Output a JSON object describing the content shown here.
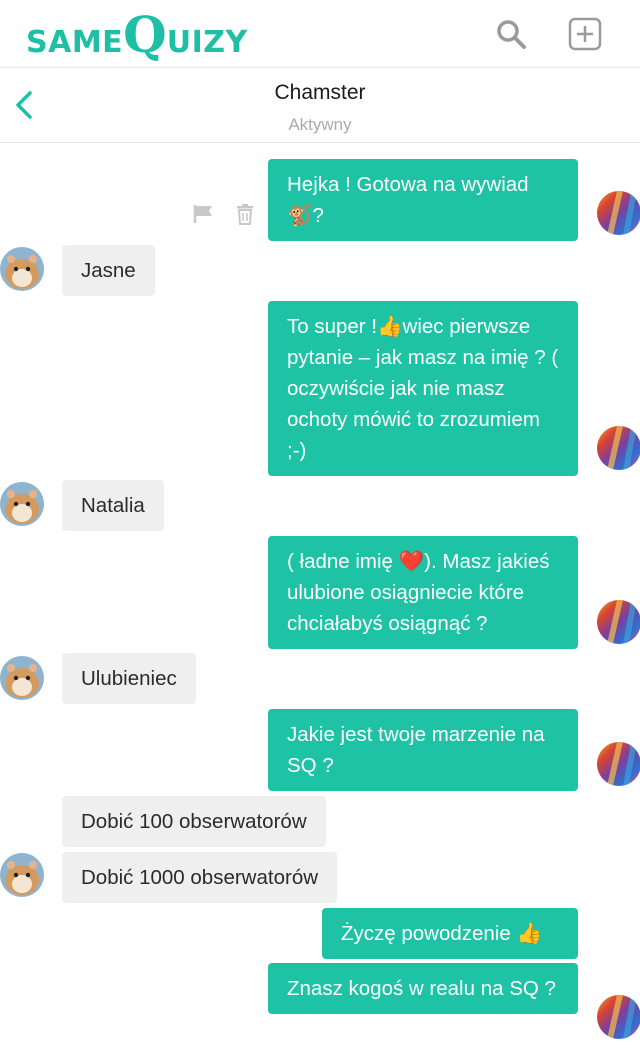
{
  "app": {
    "logo_same": "SAME",
    "logo_q": "Q",
    "logo_rest": "UIZY",
    "brand_color": "#1fbfa6"
  },
  "chat": {
    "contact_name": "Chamster",
    "status": "Aktywny"
  },
  "messages": [
    {
      "from": "me",
      "text": "Hejka ! Gotowa na wywiad 🐒?"
    },
    {
      "from": "them",
      "text": "Jasne"
    },
    {
      "from": "me",
      "text": "To super !👍wiec pierwsze pytanie – jak masz na imię ? ( oczywiście jak nie masz ochoty mówić to zrozumiem ;-)"
    },
    {
      "from": "them",
      "text": "Natalia"
    },
    {
      "from": "me",
      "text": "( ładne imię ❤️). Masz jakieś ulubione osiągniecie które chciałabyś osiągnąć ?"
    },
    {
      "from": "them",
      "text": "Ulubieniec"
    },
    {
      "from": "me",
      "text": "Jakie jest twoje marzenie na SQ ?"
    },
    {
      "from": "them",
      "text": "Dobić 100 obserwatorów"
    },
    {
      "from": "them",
      "text": "Dobić 1000 obserwatorów"
    },
    {
      "from": "me",
      "text": "Życzę powodzenie 👍"
    },
    {
      "from": "me",
      "text": "Znasz kogoś w realu na SQ ?"
    }
  ],
  "icons": {
    "search": "search-icon",
    "add": "plus-square-icon",
    "back": "chevron-left-icon",
    "report": "flag-icon",
    "delete": "trash-icon"
  }
}
